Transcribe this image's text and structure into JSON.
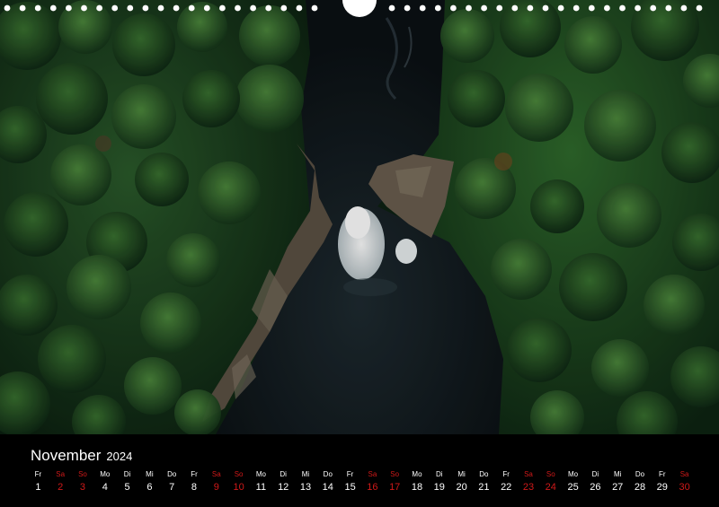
{
  "month": "November",
  "year": "2024",
  "days": [
    {
      "name": "Fr",
      "num": "1",
      "weekend": false
    },
    {
      "name": "Sa",
      "num": "2",
      "weekend": true
    },
    {
      "name": "So",
      "num": "3",
      "weekend": true
    },
    {
      "name": "Mo",
      "num": "4",
      "weekend": false
    },
    {
      "name": "Di",
      "num": "5",
      "weekend": false
    },
    {
      "name": "Mi",
      "num": "6",
      "weekend": false
    },
    {
      "name": "Do",
      "num": "7",
      "weekend": false
    },
    {
      "name": "Fr",
      "num": "8",
      "weekend": false
    },
    {
      "name": "Sa",
      "num": "9",
      "weekend": true
    },
    {
      "name": "So",
      "num": "10",
      "weekend": true
    },
    {
      "name": "Mo",
      "num": "11",
      "weekend": false
    },
    {
      "name": "Di",
      "num": "12",
      "weekend": false
    },
    {
      "name": "Mi",
      "num": "13",
      "weekend": false
    },
    {
      "name": "Do",
      "num": "14",
      "weekend": false
    },
    {
      "name": "Fr",
      "num": "15",
      "weekend": false
    },
    {
      "name": "Sa",
      "num": "16",
      "weekend": true
    },
    {
      "name": "So",
      "num": "17",
      "weekend": true
    },
    {
      "name": "Mo",
      "num": "18",
      "weekend": false
    },
    {
      "name": "Di",
      "num": "19",
      "weekend": false
    },
    {
      "name": "Mi",
      "num": "20",
      "weekend": false
    },
    {
      "name": "Do",
      "num": "21",
      "weekend": false
    },
    {
      "name": "Fr",
      "num": "22",
      "weekend": false
    },
    {
      "name": "Sa",
      "num": "23",
      "weekend": true
    },
    {
      "name": "So",
      "num": "24",
      "weekend": true
    },
    {
      "name": "Mo",
      "num": "25",
      "weekend": false
    },
    {
      "name": "Di",
      "num": "26",
      "weekend": false
    },
    {
      "name": "Mi",
      "num": "27",
      "weekend": false
    },
    {
      "name": "Do",
      "num": "28",
      "weekend": false
    },
    {
      "name": "Fr",
      "num": "29",
      "weekend": false
    },
    {
      "name": "Sa",
      "num": "30",
      "weekend": true
    }
  ],
  "colors": {
    "background": "#000000",
    "text": "#ffffff",
    "weekend": "#d01919",
    "forest_dark": "#0e2414",
    "forest_mid": "#1f4a22",
    "forest_light": "#3d7a34",
    "water": "#141c22",
    "rock": "#5c5144"
  }
}
